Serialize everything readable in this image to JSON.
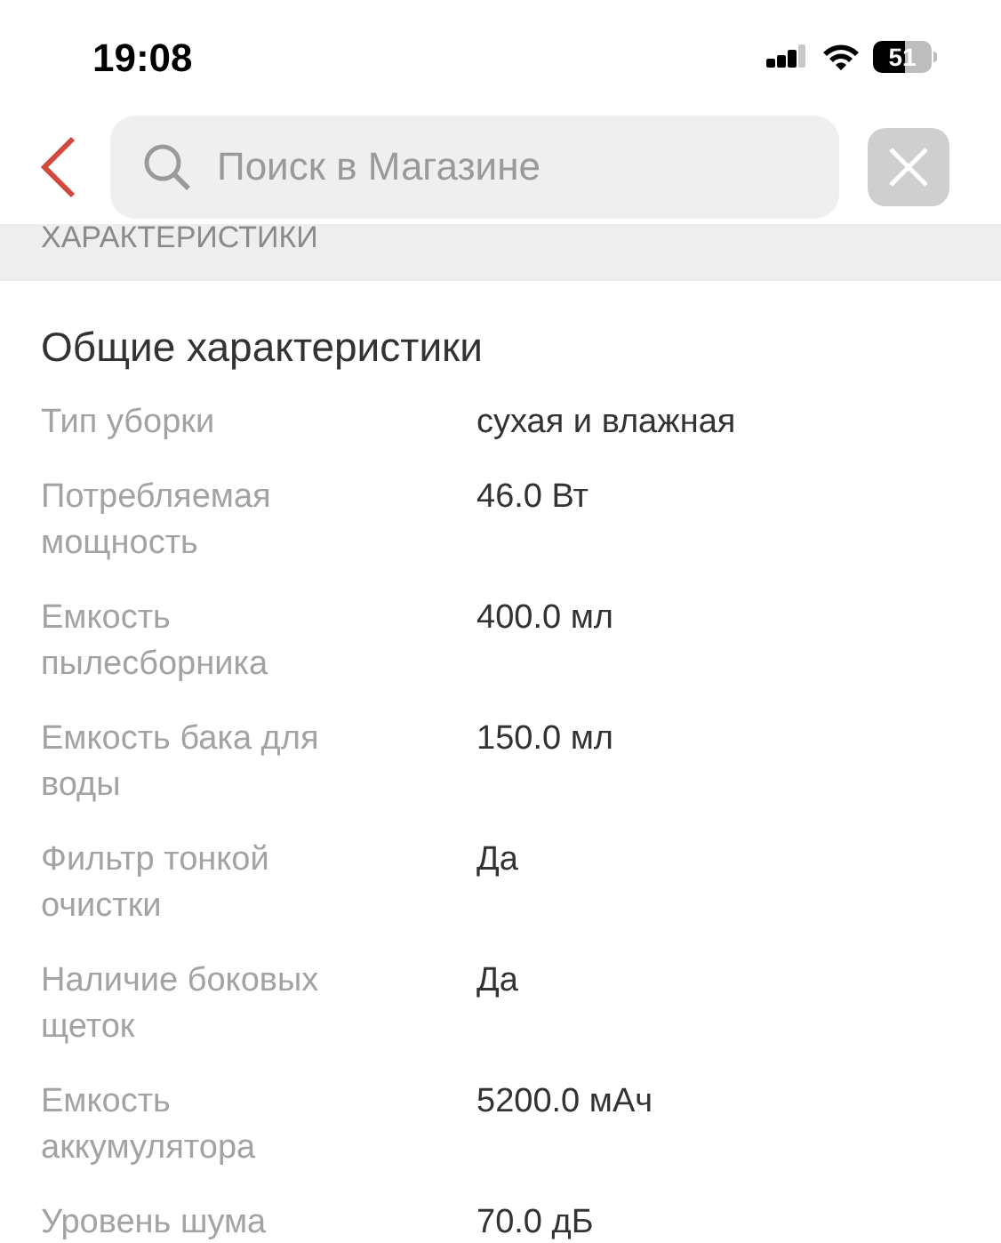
{
  "status_bar": {
    "time": "19:08",
    "battery": "51"
  },
  "search": {
    "placeholder": "Поиск в Магазине"
  },
  "section_header": "ХАРАКТЕРИСТИКИ",
  "group_title": "Общие характеристики",
  "specs": [
    {
      "label": "Тип уборки",
      "value": "сухая и влажная"
    },
    {
      "label": "Потребляемая мощность",
      "value": "46.0 Вт"
    },
    {
      "label": "Емкость пылесборника",
      "value": "400.0 мл"
    },
    {
      "label": "Емкость бака для воды",
      "value": "150.0 мл"
    },
    {
      "label": "Фильтр тонкой очистки",
      "value": "Да"
    },
    {
      "label": "Наличие боковых щеток",
      "value": "Да"
    },
    {
      "label": "Емкость аккумулятора",
      "value": "5200.0 мАч"
    },
    {
      "label": "Уровень шума",
      "value": "70.0 дБ"
    }
  ]
}
